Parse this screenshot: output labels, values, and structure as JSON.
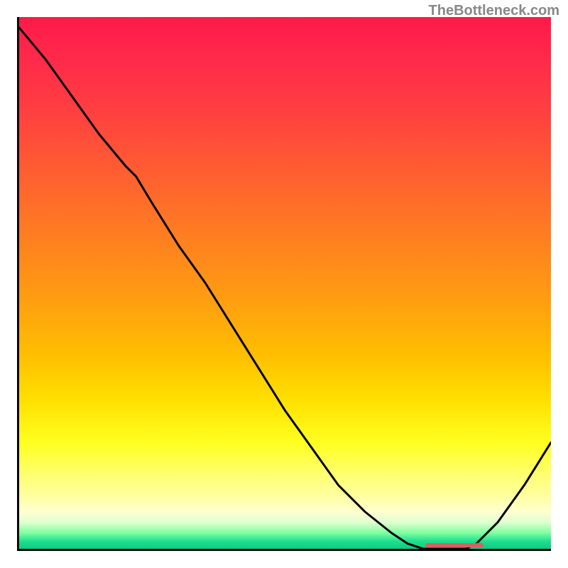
{
  "watermark": "TheBottleneck.com",
  "chart_data": {
    "type": "line",
    "title": "",
    "xlabel": "",
    "ylabel": "",
    "x": [
      0.0,
      0.05,
      0.1,
      0.15,
      0.2,
      0.22,
      0.25,
      0.3,
      0.35,
      0.4,
      0.45,
      0.5,
      0.55,
      0.6,
      0.65,
      0.7,
      0.73,
      0.76,
      0.8,
      0.84,
      0.86,
      0.9,
      0.95,
      1.0
    ],
    "values": [
      0.02,
      0.08,
      0.15,
      0.22,
      0.28,
      0.3,
      0.35,
      0.43,
      0.5,
      0.58,
      0.66,
      0.74,
      0.81,
      0.88,
      0.93,
      0.97,
      0.99,
      1.0,
      1.0,
      1.0,
      0.99,
      0.95,
      0.88,
      0.8
    ],
    "xlim": [
      0,
      1
    ],
    "ylim": [
      0,
      1
    ],
    "curve_note": "y-values shown map to visual position from top (0=top, 1=bottom); lower band is optimal",
    "optimal_band": {
      "x_start": 0.76,
      "x_end": 0.87
    },
    "gradient": {
      "top_color": "#ff1a4a",
      "mid_color": "#ffe000",
      "bottom_color": "#10c880"
    }
  }
}
